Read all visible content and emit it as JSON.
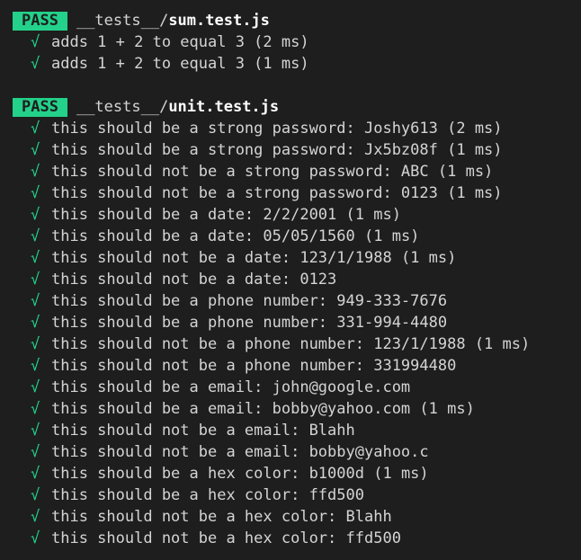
{
  "suites": [
    {
      "status": "PASS",
      "dir": "__tests__/",
      "file": "sum.test.js",
      "tests": [
        {
          "name": "adds 1 + 2 to equal 3",
          "duration": " (2 ms)"
        },
        {
          "name": "adds 1 + 2 to equal 3",
          "duration": " (1 ms)"
        }
      ]
    },
    {
      "status": "PASS",
      "dir": "__tests__/",
      "file": "unit.test.js",
      "tests": [
        {
          "name": "this should be a strong password: Joshy613",
          "duration": " (2 ms)"
        },
        {
          "name": "this should be a strong password: Jx5bz08f",
          "duration": " (1 ms)"
        },
        {
          "name": "this should not be a strong password: ABC",
          "duration": " (1 ms)"
        },
        {
          "name": "this should not be a strong password: 0123",
          "duration": " (1 ms)"
        },
        {
          "name": "this should be a date: 2/2/2001",
          "duration": " (1 ms)"
        },
        {
          "name": "this should be a date: 05/05/1560",
          "duration": " (1 ms)"
        },
        {
          "name": "this should not be a date: 123/1/1988",
          "duration": " (1 ms)"
        },
        {
          "name": "this should not be a date: 0123",
          "duration": ""
        },
        {
          "name": "this should be a phone number: 949-333-7676",
          "duration": ""
        },
        {
          "name": "this should be a phone number: 331-994-4480",
          "duration": ""
        },
        {
          "name": "this should not be a phone number: 123/1/1988",
          "duration": " (1 ms)"
        },
        {
          "name": "this should not be a phone number: 331994480",
          "duration": ""
        },
        {
          "name": "this should be a email: john@google.com",
          "duration": ""
        },
        {
          "name": "this should be a email: bobby@yahoo.com",
          "duration": " (1 ms)"
        },
        {
          "name": "this should not be a email: Blahh",
          "duration": ""
        },
        {
          "name": "this should not be a email: bobby@yahoo.c",
          "duration": ""
        },
        {
          "name": "this should be a hex color: b1000d",
          "duration": " (1 ms)"
        },
        {
          "name": "this should be a hex color: ffd500",
          "duration": ""
        },
        {
          "name": "this should not be a hex color: Blahh",
          "duration": ""
        },
        {
          "name": "this should not be a hex color: ffd500",
          "duration": ""
        }
      ]
    }
  ],
  "icons": {
    "check": "√"
  },
  "colors": {
    "background": "#1e1e1e",
    "pass_badge": "#23d18b",
    "check": "#23d18b",
    "text": "#d4d4d4",
    "file": "#ffffff"
  }
}
